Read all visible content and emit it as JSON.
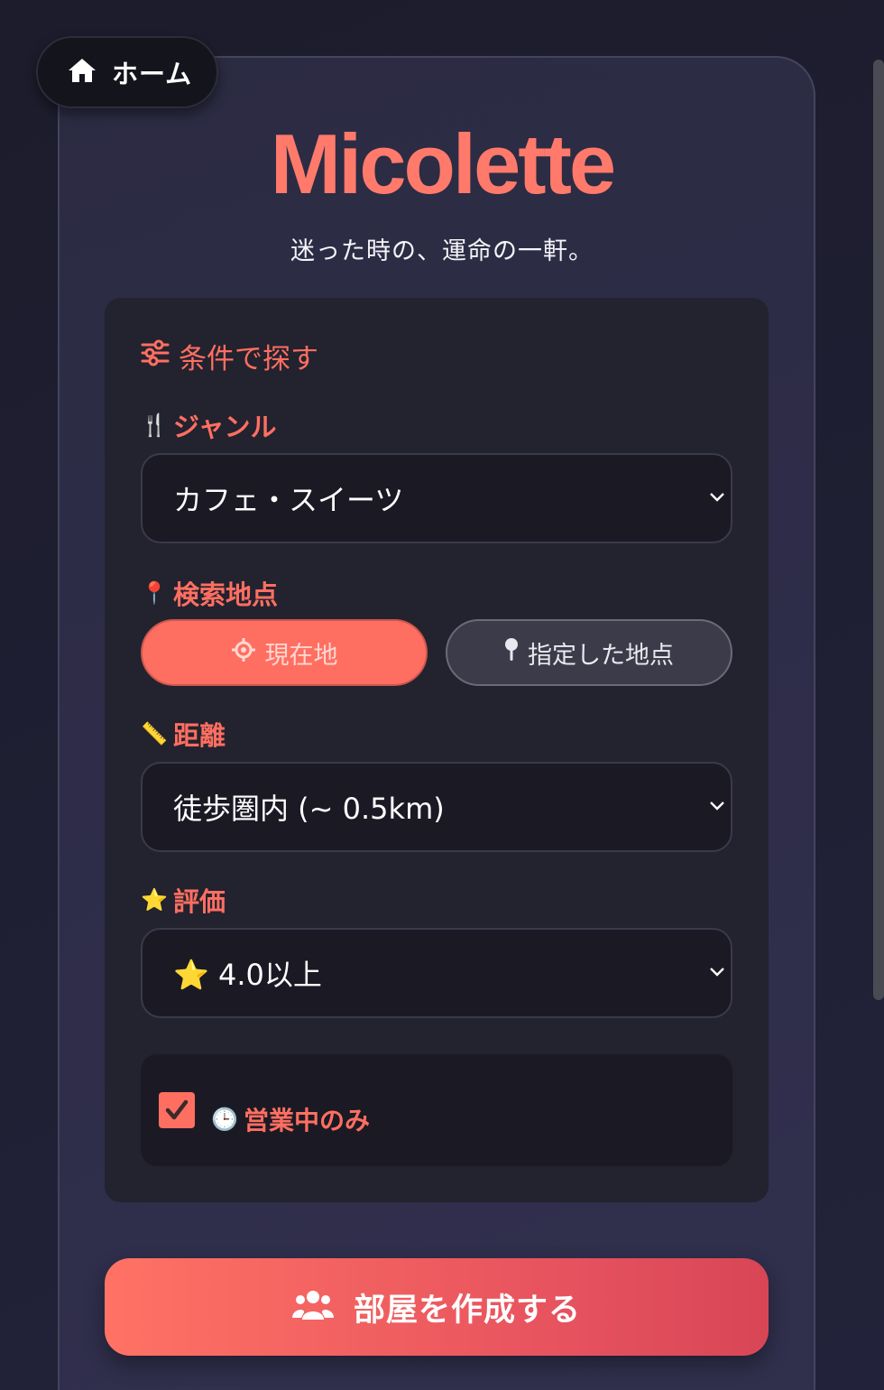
{
  "nav": {
    "home_label": "ホーム",
    "home_icon": "home-icon"
  },
  "brand": {
    "title": "Micolette",
    "tagline": "迷った時の、運命の一軒。",
    "accent_color": "#ff6f61"
  },
  "filters": {
    "title": "条件で探す",
    "title_icon": "sliders-icon",
    "genre": {
      "emoji": "🍴",
      "label": "ジャンル",
      "selected": "カフェ・スイーツ"
    },
    "location": {
      "emoji": "📍",
      "label": "検索地点",
      "options": [
        {
          "label": "現在地",
          "icon": "crosshair-icon",
          "active": true
        },
        {
          "label": "指定した地点",
          "icon": "pin-icon",
          "active": false
        }
      ]
    },
    "distance": {
      "emoji": "📏",
      "label": "距離",
      "selected": "徒歩圏内 (~ 0.5km)"
    },
    "rating": {
      "emoji": "⭐",
      "label": "評価",
      "selected": "⭐ 4.0以上"
    },
    "open_now": {
      "emoji": "🕒",
      "label": "営業中のみ",
      "checked": true
    }
  },
  "actions": {
    "create_room_label": "部屋を作成する",
    "create_room_icon": "users-icon"
  }
}
